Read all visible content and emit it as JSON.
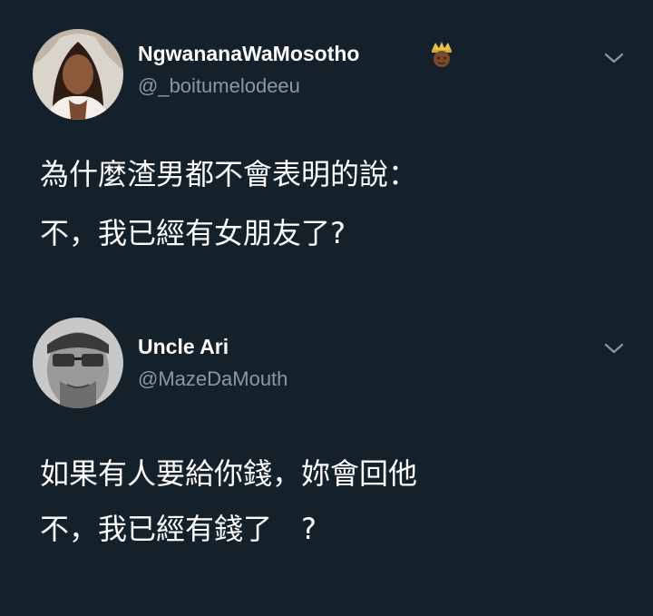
{
  "tweets": [
    {
      "display_name": "NgwananaWaMosotho",
      "handle": "@_boitumelodeeu",
      "badge_icon": "crown-emoji-icon",
      "body_lines": [
        "為什麼渣男都不會表明的說：",
        "不，我已經有女朋友了?"
      ]
    },
    {
      "display_name": "Uncle Ari",
      "handle": "@MazeDaMouth",
      "body_lines": [
        "如果有人要給你錢，妳會回他",
        "不，我已經有錢了　?"
      ]
    }
  ],
  "colors": {
    "background": "#14202a",
    "text_primary": "#ffffff",
    "text_secondary": "#8899a6"
  },
  "icons": {
    "menu": "chevron-down-icon"
  }
}
